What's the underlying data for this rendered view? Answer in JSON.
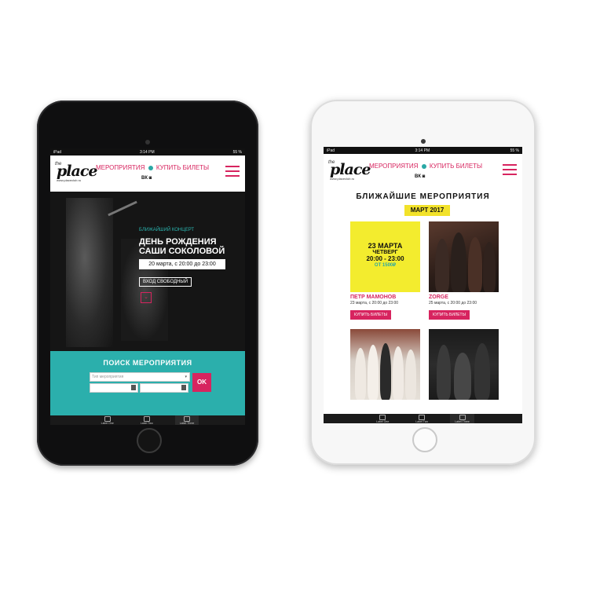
{
  "left_screen": {
    "status": {
      "device": "iPad",
      "time": "3:14 PM",
      "battery": "55 %"
    },
    "header": {
      "logo_word": "place",
      "logo_prefix": "the",
      "logo_url": "www.placeclub.ru",
      "nav_events": "МЕРОПРИЯТИЯ",
      "nav_tickets": "КУПИТЬ БИЛЕТЫ",
      "social_vk": "ВК",
      "social_ig": "◙"
    },
    "hero": {
      "subtitle": "БЛИЖАЙШИЙ КОНЦЕРТ",
      "title": "ДЕНЬ РОЖДЕНИЯ САШИ СОКОЛОВОЙ",
      "date": "20 марта, с 20:00 до 23:00",
      "entry": "ВХОД СВОБОДНЫЙ"
    },
    "search": {
      "title": "ПОИСК МЕРОПРИЯТИЯ",
      "type_placeholder": "Тип мероприятия",
      "ok": "OK"
    },
    "tabbar": [
      "Label One",
      "Label Two",
      "Label Three"
    ]
  },
  "right_screen": {
    "status": {
      "device": "iPad",
      "time": "3:14 PM",
      "battery": "55 %"
    },
    "header": {
      "logo_word": "place",
      "logo_prefix": "the",
      "logo_url": "www.placeclub.ru",
      "nav_events": "МЕРОПРИЯТИЯ",
      "nav_tickets": "КУПИТЬ БИЛЕТЫ",
      "social_vk": "ВК",
      "social_ig": "◙"
    },
    "events": {
      "title": "БЛИЖАЙШИЕ МЕРОПРИЯТИЯ",
      "month": "МАРТ 2017",
      "cards": [
        {
          "name": "ПЕТР МАМОНОВ",
          "date": "23 марта, с 20:00 до 23:00",
          "buy": "КУПИТЬ БИЛЕТЫ",
          "poster": {
            "day": "23 МАРТА",
            "weekday": "ЧЕТВЕРГ",
            "time": "20:00 - 23:00",
            "price": "ОТ 1500₽"
          }
        },
        {
          "name": "ZORGE",
          "date": "25 марта, с 20:00 до 23:00",
          "buy": "КУПИТЬ БИЛЕТЫ"
        },
        {
          "name": "",
          "date": "",
          "buy": ""
        },
        {
          "name": "",
          "date": "",
          "buy": ""
        }
      ]
    },
    "tabbar": [
      "Label One",
      "Label Two",
      "Label Three"
    ]
  },
  "colors": {
    "accent": "#d7245f",
    "teal": "#2bafac",
    "yellow": "#f3ec2e"
  }
}
